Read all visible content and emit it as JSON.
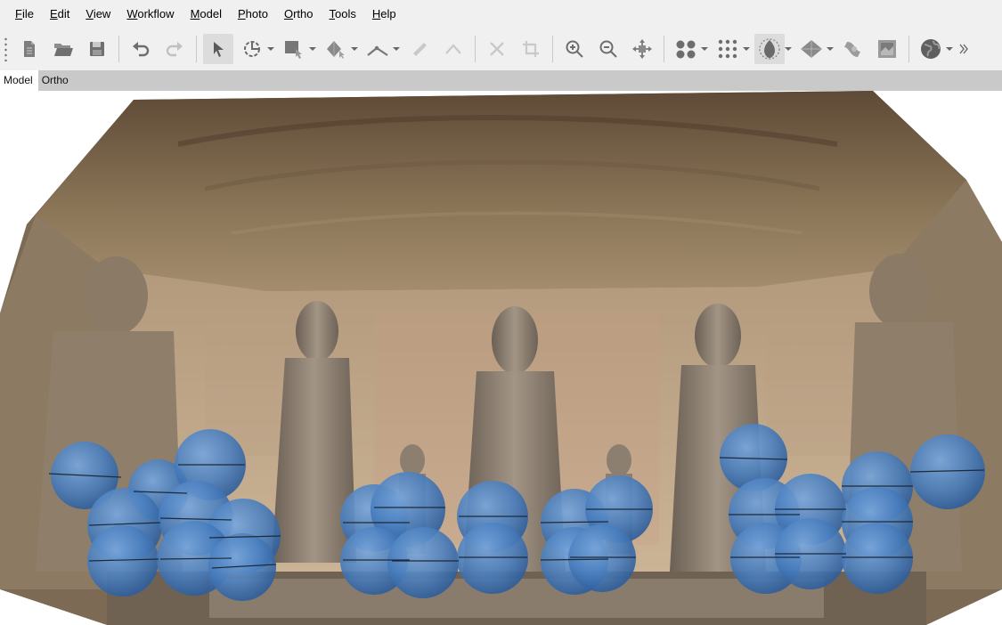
{
  "menubar": {
    "items": [
      {
        "mnemonic": "F",
        "rest": "ile"
      },
      {
        "mnemonic": "E",
        "rest": "dit"
      },
      {
        "mnemonic": "V",
        "rest": "iew"
      },
      {
        "mnemonic": "W",
        "rest": "orkflow"
      },
      {
        "mnemonic": "M",
        "rest": "odel"
      },
      {
        "mnemonic": "P",
        "rest": "hoto"
      },
      {
        "mnemonic": "O",
        "rest": "rtho"
      },
      {
        "mnemonic": "T",
        "rest": "ools"
      },
      {
        "mnemonic": "H",
        "rest": "elp"
      }
    ]
  },
  "toolbar": {
    "icons": [
      "new-icon",
      "open-icon",
      "save-icon",
      "undo-icon",
      "redo-icon",
      "navigation-icon",
      "rotate-icon",
      "rectangle-selection-icon",
      "ruler-icon",
      "shape-icon",
      "measure-icon",
      "delete-icon",
      "crop-icon",
      "zoom-in-icon",
      "zoom-out-icon",
      "reset-view-icon",
      "point-cloud-icon",
      "dense-cloud-icon",
      "mesh-icon",
      "tiled-model-icon",
      "dem-icon",
      "orthomosaic-icon",
      "globe-icon"
    ]
  },
  "tabs": {
    "model": "Model",
    "ortho": "Ortho"
  },
  "viewport": {
    "content": "3D model of cave with five standing Buddha statues and camera positions shown as blue spheres",
    "colors": {
      "sphere": "#4a7fbf",
      "rock": "#8a7356",
      "wall": "#c7ad8e"
    }
  }
}
